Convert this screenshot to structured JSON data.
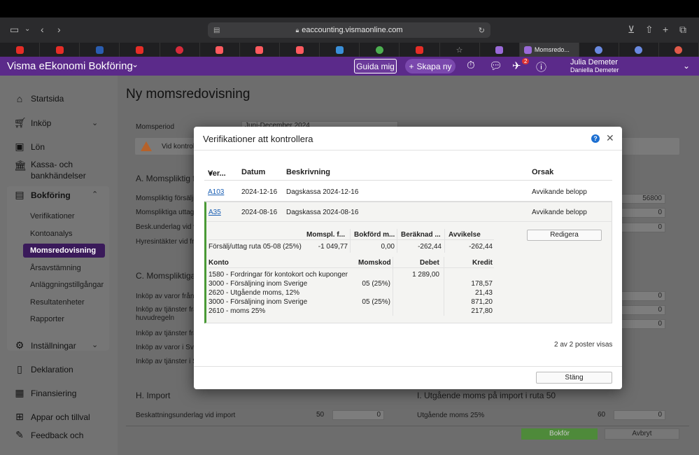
{
  "browser": {
    "url": "eaccounting.vismaonline.com",
    "active_tab_label": "Momsredo..."
  },
  "app": {
    "title": "Visma eEkonomi Bokföring",
    "guide_label": "Guida mig",
    "create_label": "Skapa ny",
    "notification_count": "2",
    "user_name": "Julia Demeter",
    "user_org": "Daniella Demeter"
  },
  "sidebar": {
    "items": [
      {
        "label": "Startsida",
        "icon": "home-icon"
      },
      {
        "label": "Inköp",
        "icon": "cart-icon"
      },
      {
        "label": "Lön",
        "icon": "wallet-icon"
      },
      {
        "label": "Kassa- och",
        "label2": "bankhändelser",
        "icon": "bank-icon"
      },
      {
        "label": "Bokföring",
        "icon": "ledger-icon"
      },
      {
        "label": "Inställningar",
        "icon": "gear-icon"
      },
      {
        "label": "Deklaration",
        "icon": "document-icon"
      },
      {
        "label": "Finansiering",
        "icon": "finance-icon"
      },
      {
        "label": "Appar och tillval",
        "icon": "apps-icon"
      },
      {
        "label": "Feedback och",
        "icon": "feedback-icon"
      }
    ],
    "sub_items": [
      "Verifikationer",
      "Kontoanalys",
      "Momsredovisning",
      "Årsavstämning",
      "Anläggningstillgångar",
      "Resultatenheter",
      "Rapporter"
    ]
  },
  "main": {
    "title": "Ny momsredovisning",
    "period_label": "Momsperiod",
    "period_value": "Juni-December 2024",
    "warn_text": "Vid kontrol",
    "section_a": "A. Momspliktig f",
    "rows_a": [
      "Momspliktig försäljn",
      "Momspliktiga uttag",
      "Besk.underlag vid vi",
      "Hyresintäkter vid fri"
    ],
    "section_c": "C. Momspliktiga",
    "rows_c": [
      "Inköp av varor från a",
      "Inköp av tjänster frå",
      "huvudregeln",
      "Inköp av tjänster frå",
      "Inköp av varor i Sver",
      "Inköp av tjänster i Sv"
    ],
    "field_values_right": [
      "56800",
      "0",
      "0",
      "0",
      "0",
      "0"
    ],
    "section_h": "H. Import",
    "import_label": "Beskattningsunderlag vid import",
    "import_code": "50",
    "import_value": "0",
    "section_i": "I. Utgående moms på import i ruta 50",
    "import_vat_label": "Utgående moms 25%",
    "import_vat_code": "60",
    "import_vat_value": "0",
    "bokfor_label": "Bokför",
    "avbryt_label": "Avbryt"
  },
  "modal": {
    "title": "Verifikationer att kontrollera",
    "columns": {
      "ver": "Ver...",
      "datum": "Datum",
      "beskrivning": "Beskrivning",
      "orsak": "Orsak"
    },
    "rows": [
      {
        "ver": "A103",
        "datum": "2024-12-16",
        "beskrivning": "Dagskassa 2024-12-16",
        "orsak": "Avvikande belopp"
      },
      {
        "ver": "A35",
        "datum": "2024-08-16",
        "beskrivning": "Dagskassa 2024-08-16",
        "orsak": "Avvikande belopp"
      }
    ],
    "detail": {
      "headers": [
        "Momspl. f...",
        "Bokförd m...",
        "Beräknad ...",
        "Avvikelse"
      ],
      "row_label": "Försälj/uttag ruta 05-08 (25%)",
      "values": [
        "-1 049,77",
        "0,00",
        "-262,44",
        "-262,44"
      ],
      "edit_label": "Redigera",
      "acc_headers": {
        "konto": "Konto",
        "momskod": "Momskod",
        "debet": "Debet",
        "kredit": "Kredit"
      },
      "accounts": [
        {
          "konto": "1580 - Fordringar för kontokort och kuponger",
          "momskod": "",
          "debet": "1 289,00",
          "kredit": ""
        },
        {
          "konto": "3000 - Försäljning inom Sverige",
          "momskod": "05 (25%)",
          "debet": "",
          "kredit": "178,57"
        },
        {
          "konto": "2620 - Utgående moms, 12%",
          "momskod": "",
          "debet": "",
          "kredit": "21,43"
        },
        {
          "konto": "3000 - Försäljning inom Sverige",
          "momskod": "05 (25%)",
          "debet": "",
          "kredit": "871,20"
        },
        {
          "konto": "2610 - moms 25%",
          "momskod": "",
          "debet": "",
          "kredit": "217,80"
        }
      ]
    },
    "summary": "2 av 2 poster visas",
    "close_label": "Stäng"
  }
}
